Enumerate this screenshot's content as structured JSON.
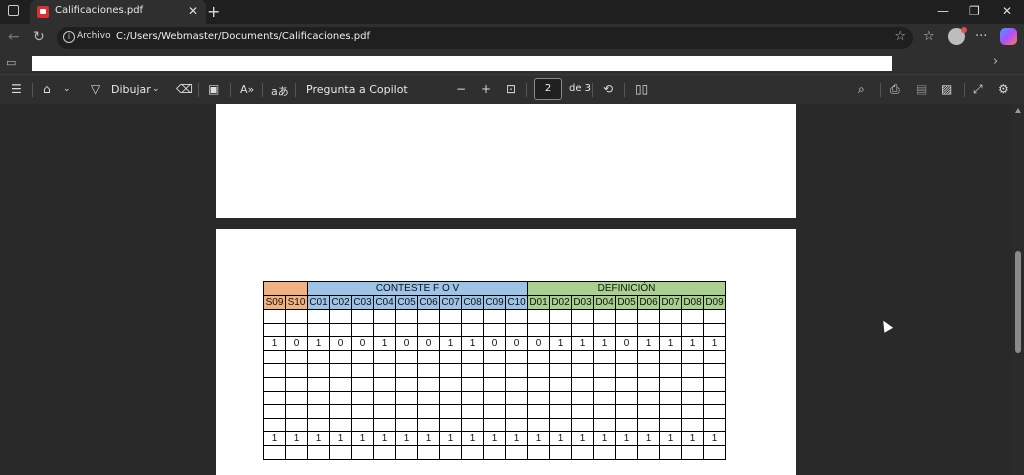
{
  "tab": {
    "title": "Calificaciones.pdf",
    "close": "✕",
    "new_tab": "+"
  },
  "window": {
    "minimize": "—",
    "restore": "❐",
    "close": "✕"
  },
  "address": {
    "chip": "Archivo",
    "url": "C:/Users/Webmaster/Documents/Calificaciones.pdf"
  },
  "pdf_toolbar": {
    "draw_label": "Dibujar",
    "copilot_label": "Pregunta a Copilot",
    "page_current": "2",
    "page_total": "de 3"
  },
  "table": {
    "group_headers": [
      {
        "label": "",
        "span": 2,
        "color": "#f2b183"
      },
      {
        "label": "CONTESTE F O V",
        "span": 10,
        "color": "#9dc3e6"
      },
      {
        "label": "DEFINICIÓN",
        "span": 9,
        "color": "#a9d08e"
      }
    ],
    "columns": [
      "S09",
      "S10",
      "C01",
      "C02",
      "C03",
      "C04",
      "C05",
      "C06",
      "C07",
      "C08",
      "C09",
      "C10",
      "D01",
      "D02",
      "D03",
      "D04",
      "D05",
      "D06",
      "D07",
      "D08",
      "D09"
    ],
    "rows": [
      [
        "",
        "",
        "",
        "",
        "",
        "",
        "",
        "",
        "",
        "",
        "",
        "",
        "",
        "",
        "",
        "",
        "",
        "",
        "",
        "",
        ""
      ],
      [
        "",
        "",
        "",
        "",
        "",
        "",
        "",
        "",
        "",
        "",
        "",
        "",
        "",
        "",
        "",
        "",
        "",
        "",
        "",
        "",
        ""
      ],
      [
        "1",
        "0",
        "1",
        "0",
        "0",
        "1",
        "0",
        "0",
        "1",
        "1",
        "0",
        "0",
        "0",
        "1",
        "1",
        "1",
        "0",
        "1",
        "1",
        "1",
        "1"
      ],
      [
        "",
        "",
        "",
        "",
        "",
        "",
        "",
        "",
        "",
        "",
        "",
        "",
        "",
        "",
        "",
        "",
        "",
        "",
        "",
        "",
        ""
      ],
      [
        "",
        "",
        "",
        "",
        "",
        "",
        "",
        "",
        "",
        "",
        "",
        "",
        "",
        "",
        "",
        "",
        "",
        "",
        "",
        "",
        ""
      ],
      [
        "",
        "",
        "",
        "",
        "",
        "",
        "",
        "",
        "",
        "",
        "",
        "",
        "",
        "",
        "",
        "",
        "",
        "",
        "",
        "",
        ""
      ],
      [
        "",
        "",
        "",
        "",
        "",
        "",
        "",
        "",
        "",
        "",
        "",
        "",
        "",
        "",
        "",
        "",
        "",
        "",
        "",
        "",
        ""
      ],
      [
        "",
        "",
        "",
        "",
        "",
        "",
        "",
        "",
        "",
        "",
        "",
        "",
        "",
        "",
        "",
        "",
        "",
        "",
        "",
        "",
        ""
      ],
      [
        "",
        "",
        "",
        "",
        "",
        "",
        "",
        "",
        "",
        "",
        "",
        "",
        "",
        "",
        "",
        "",
        "",
        "",
        "",
        "",
        ""
      ],
      [
        "1",
        "1",
        "1",
        "1",
        "1",
        "1",
        "1",
        "1",
        "1",
        "1",
        "1",
        "1",
        "1",
        "1",
        "1",
        "1",
        "1",
        "1",
        "1",
        "1",
        "1"
      ],
      [
        "",
        "",
        "",
        "",
        "",
        "",
        "",
        "",
        "",
        "",
        "",
        "",
        "",
        "",
        "",
        "",
        "",
        "",
        "",
        "",
        ""
      ]
    ]
  }
}
